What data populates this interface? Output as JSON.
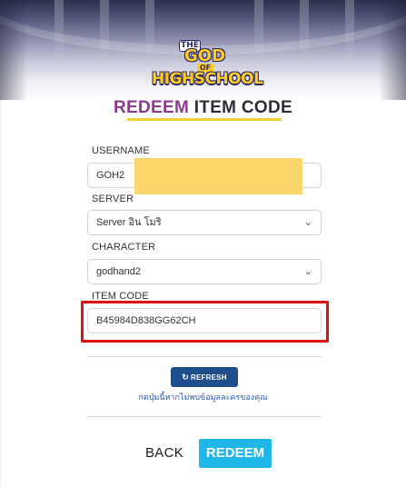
{
  "logo": {
    "the": "THE",
    "god": "GOD",
    "of": "OF",
    "highschool": "HIGHSCHOOL"
  },
  "heading": {
    "part1": "REDEEM",
    "part2": "ITEM CODE",
    "accent_color": "#8b3a8f",
    "underline_color": "#f2cf33"
  },
  "form": {
    "username": {
      "label": "USERNAME",
      "value": "GOH2"
    },
    "server": {
      "label": "SERVER",
      "value": "Server อิน โมริ"
    },
    "character": {
      "label": "CHARACTER",
      "value": "godhand2"
    },
    "item_code": {
      "label": "ITEM CODE",
      "value": "B45984D838GG62CH"
    }
  },
  "refresh": {
    "icon": "refresh-icon",
    "label": "REFRESH",
    "hint": "กดปุ่มนี้หากไม่พบข้อมูลละครของคุณ"
  },
  "actions": {
    "back_label": "BACK",
    "redeem_label": "REDEEM",
    "redeem_color": "#1fb6e8"
  },
  "annotation": {
    "highlight_color": "#e01111",
    "redaction_color": "#f9d76a"
  }
}
